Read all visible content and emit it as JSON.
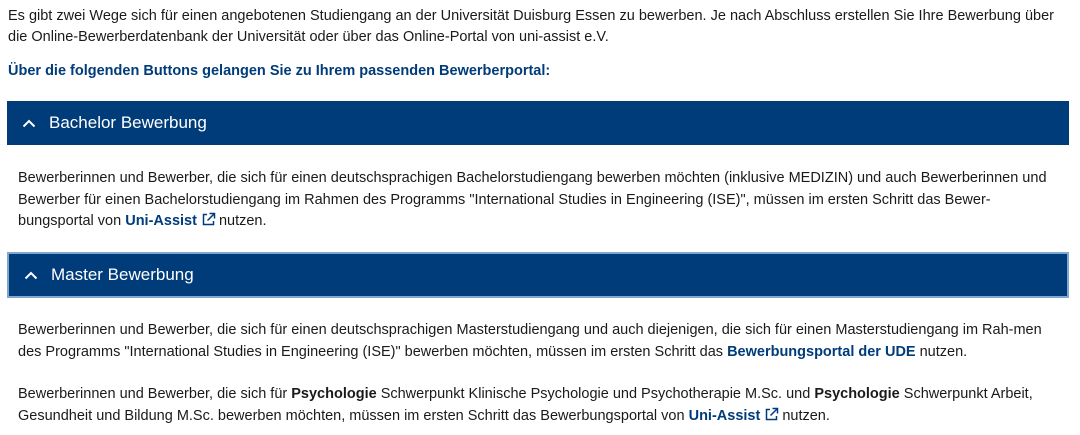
{
  "intro": {
    "text": "Es gibt zwei Wege sich für einen angebotenen Studiengang an der Universität Duisburg Essen zu bewerben. Je nach Abschluss erstellen Sie Ihre Bewerbung über die Online-Bewerberdatenbank der Universität oder über das Online-Portal von uni-assist e.V."
  },
  "lead": {
    "text": "Über die folgenden Buttons gelangen Sie zu Ihrem passenden Bewerberportal:"
  },
  "colors": {
    "brand": "#003b7a",
    "focus_border": "#7fa7cf"
  },
  "accordion": {
    "bachelor": {
      "title": "Bachelor Bewerbung",
      "icon": "chevron-up-icon",
      "body_before": "Bewerberinnen und Bewerber, die sich für einen deutschsprachigen Bachelorstudiengang bewerben möchten (inklusive MEDIZIN) und auch Bewerberinnen und Bewerber für einen Bachelorstudiengang im Rahmen des Programms \"International Studies in Engineering (ISE)\", müssen im ersten Schritt das Bewer-bungsportal von ",
      "link": "Uni-Assist",
      "link_icon": "external-link-icon",
      "body_after": "nutzen."
    },
    "master": {
      "title": "Master Bewerbung",
      "icon": "chevron-up-icon",
      "p1_before": "Bewerberinnen und Bewerber, die sich für einen deutschsprachigen Masterstudiengang  und auch diejenigen, die sich für einen Masterstudiengang im Rah-men des Programms \"International Studies in Engineering (ISE)\" bewerben möchten, müssen im ersten Schritt das ",
      "p1_link": "Bewerbungsportal der UDE",
      "p1_after": " nutzen.",
      "p2_a": "Bewerberinnen und Bewerber, die sich für ",
      "p2_bold1": "Psychologie",
      "p2_b": " Schwerpunkt Klinische Psychologie und Psychotherapie M.Sc. und ",
      "p2_bold2": "Psychologie",
      "p2_c": " Schwerpunkt Arbeit, Gesundheit und Bildung M.Sc. bewerben möchten, müssen im ersten Schritt das Bewerbungsportal von ",
      "p2_link": "Uni-Assist",
      "p2_link_icon": "external-link-icon",
      "p2_after": "nutzen."
    }
  }
}
